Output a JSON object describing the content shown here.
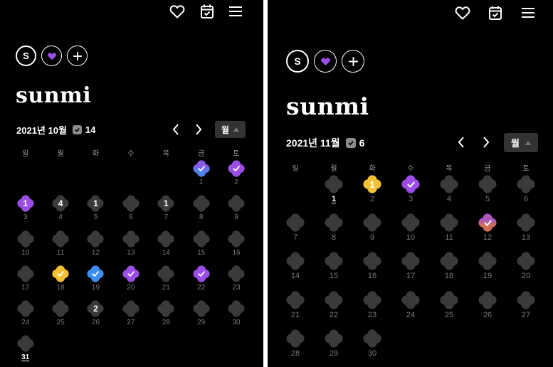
{
  "colors": {
    "background": "#000000",
    "empty_day": "#3a3a3a",
    "purple": "#9b4de5",
    "blue": "#3d8ef0",
    "yellow": "#f2c233",
    "orange": "#e4782e"
  },
  "toolbar": {
    "icons": [
      "heart-icon",
      "calendar-check-icon",
      "menu-icon"
    ]
  },
  "left": {
    "profile": {
      "avatar_letter": "S",
      "emoji": "💜",
      "add_label": "+",
      "username": "sunmi"
    },
    "header": {
      "month_label": "2021년 10월",
      "count": "14",
      "view_label": "월"
    },
    "weekdays": [
      "일",
      "월",
      "화",
      "수",
      "목",
      "금",
      "토"
    ],
    "days": [
      {
        "day": "",
        "type": "blank"
      },
      {
        "day": "",
        "type": "blank"
      },
      {
        "day": "",
        "type": "blank"
      },
      {
        "day": "",
        "type": "blank"
      },
      {
        "day": "",
        "type": "blank"
      },
      {
        "day": "1",
        "type": "check",
        "colors": [
          "#9b4de5",
          "#3d8ef0"
        ]
      },
      {
        "day": "2",
        "type": "check",
        "colors": [
          "#9b4de5"
        ]
      },
      {
        "day": "3",
        "type": "count",
        "count": "1",
        "colors": [
          "#9b4de5"
        ]
      },
      {
        "day": "4",
        "type": "count",
        "count": "4"
      },
      {
        "day": "5",
        "type": "count",
        "count": "1"
      },
      {
        "day": "6",
        "type": "empty"
      },
      {
        "day": "7",
        "type": "count",
        "count": "1"
      },
      {
        "day": "8",
        "type": "empty"
      },
      {
        "day": "9",
        "type": "empty"
      },
      {
        "day": "10",
        "type": "empty"
      },
      {
        "day": "11",
        "type": "empty"
      },
      {
        "day": "12",
        "type": "empty"
      },
      {
        "day": "13",
        "type": "empty"
      },
      {
        "day": "14",
        "type": "empty"
      },
      {
        "day": "15",
        "type": "empty"
      },
      {
        "day": "16",
        "type": "empty"
      },
      {
        "day": "17",
        "type": "empty"
      },
      {
        "day": "18",
        "type": "check",
        "colors": [
          "#f2c233"
        ]
      },
      {
        "day": "19",
        "type": "check",
        "colors": [
          "#3d8ef0"
        ]
      },
      {
        "day": "20",
        "type": "check",
        "colors": [
          "#9b4de5"
        ]
      },
      {
        "day": "21",
        "type": "empty"
      },
      {
        "day": "22",
        "type": "check",
        "colors": [
          "#9b4de5"
        ]
      },
      {
        "day": "23",
        "type": "empty"
      },
      {
        "day": "24",
        "type": "empty"
      },
      {
        "day": "25",
        "type": "empty"
      },
      {
        "day": "26",
        "type": "count",
        "count": "2"
      },
      {
        "day": "27",
        "type": "empty"
      },
      {
        "day": "28",
        "type": "empty"
      },
      {
        "day": "29",
        "type": "empty"
      },
      {
        "day": "30",
        "type": "empty"
      },
      {
        "day": "31",
        "type": "empty",
        "today": true
      }
    ]
  },
  "right": {
    "profile": {
      "avatar_letter": "S",
      "emoji": "💜",
      "add_label": "+",
      "username": "sunmi"
    },
    "header": {
      "month_label": "2021년 11월",
      "count": "6",
      "view_label": "월"
    },
    "weekdays": [
      "일",
      "월",
      "화",
      "수",
      "목",
      "금",
      "토"
    ],
    "days": [
      {
        "day": "",
        "type": "blank"
      },
      {
        "day": "1",
        "type": "empty",
        "today": true
      },
      {
        "day": "2",
        "type": "count",
        "count": "1",
        "colors": [
          "#f2c233"
        ]
      },
      {
        "day": "3",
        "type": "check",
        "colors": [
          "#9b4de5"
        ]
      },
      {
        "day": "4",
        "type": "empty"
      },
      {
        "day": "5",
        "type": "empty"
      },
      {
        "day": "6",
        "type": "empty"
      },
      {
        "day": "7",
        "type": "empty"
      },
      {
        "day": "8",
        "type": "empty"
      },
      {
        "day": "9",
        "type": "empty"
      },
      {
        "day": "10",
        "type": "empty"
      },
      {
        "day": "11",
        "type": "empty"
      },
      {
        "day": "12",
        "type": "check",
        "colors": [
          "#9b4de5",
          "#e4782e"
        ]
      },
      {
        "day": "13",
        "type": "empty"
      },
      {
        "day": "14",
        "type": "empty"
      },
      {
        "day": "15",
        "type": "empty"
      },
      {
        "day": "16",
        "type": "empty"
      },
      {
        "day": "17",
        "type": "empty"
      },
      {
        "day": "18",
        "type": "empty"
      },
      {
        "day": "19",
        "type": "empty"
      },
      {
        "day": "20",
        "type": "empty"
      },
      {
        "day": "21",
        "type": "empty"
      },
      {
        "day": "22",
        "type": "empty"
      },
      {
        "day": "23",
        "type": "empty"
      },
      {
        "day": "24",
        "type": "empty"
      },
      {
        "day": "25",
        "type": "empty"
      },
      {
        "day": "26",
        "type": "empty"
      },
      {
        "day": "27",
        "type": "empty"
      },
      {
        "day": "28",
        "type": "empty"
      },
      {
        "day": "29",
        "type": "empty"
      },
      {
        "day": "30",
        "type": "empty"
      }
    ]
  }
}
